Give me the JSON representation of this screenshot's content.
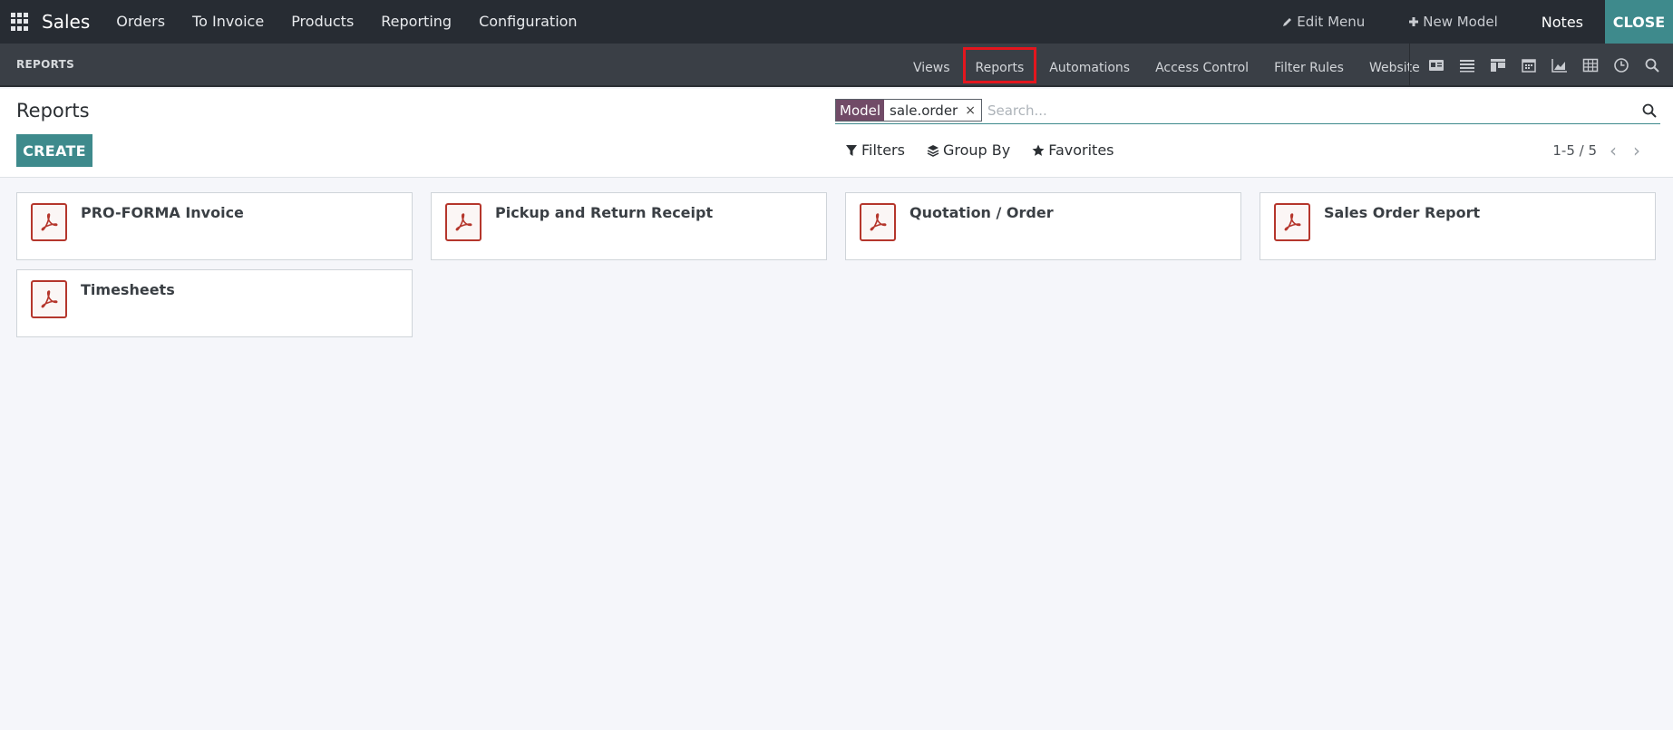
{
  "topbar": {
    "app_name": "Sales",
    "menu": [
      "Orders",
      "To Invoice",
      "Products",
      "Reporting",
      "Configuration"
    ],
    "edit_menu": "Edit Menu",
    "new_model": "New Model",
    "notes": "Notes",
    "close": "CLOSE"
  },
  "studio": {
    "section_title": "REPORTS",
    "tabs": [
      "Views",
      "Reports",
      "Automations",
      "Access Control",
      "Filter Rules",
      "Website"
    ],
    "active_tab": "Reports",
    "view_icons": [
      "form-view-icon",
      "list-view-icon",
      "kanban-view-icon",
      "calendar-view-icon",
      "graph-view-icon",
      "pivot-view-icon",
      "activity-view-icon",
      "search-view-icon"
    ]
  },
  "control": {
    "title": "Reports",
    "create_label": "CREATE",
    "search": {
      "facet_label": "Model",
      "facet_value": "sale.order",
      "placeholder": "Search..."
    },
    "filters_label": "Filters",
    "group_by_label": "Group By",
    "favorites_label": "Favorites",
    "pager": "1-5 / 5"
  },
  "reports": [
    {
      "name": "PRO-FORMA Invoice"
    },
    {
      "name": "Pickup and Return Receipt"
    },
    {
      "name": "Quotation / Order"
    },
    {
      "name": "Sales Order Report"
    },
    {
      "name": "Timesheets"
    }
  ],
  "colors": {
    "navbar": "#272c33",
    "studio_bar": "#3a3f46",
    "accent": "#3e8a8c",
    "facet": "#714b67",
    "pdf_red": "#b5362c",
    "highlight": "#e3161e"
  }
}
